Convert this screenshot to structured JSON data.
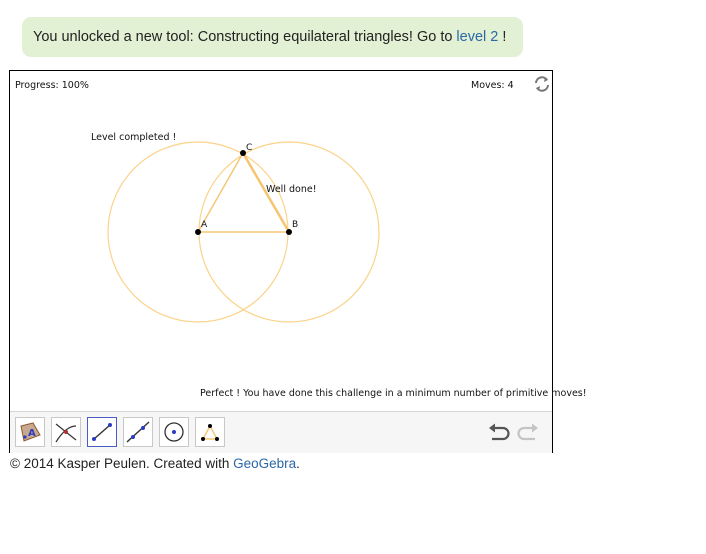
{
  "banner": {
    "text_before": "You unlocked a new tool: Constructing equilateral triangles! Go to",
    "link": "level 2",
    "text_after": "!"
  },
  "applet": {
    "progress": "Progress: 100%",
    "moves": "Moves: 4",
    "level_completed": "Level completed !",
    "well_done": "Well done!",
    "perfect": "Perfect ! You have done this challenge in a minimum number of primitive moves!",
    "points": {
      "a": "A",
      "b": "B",
      "c": "C"
    },
    "colors": {
      "circle": "#fbd38a",
      "segment": "#f6c572",
      "point": "#000000",
      "selected_tool": "#4a5bc4"
    },
    "icons": [
      "refresh-icon",
      "polygon-tool-icon",
      "intersect-tool-icon",
      "segment-tool-icon",
      "line-tool-icon",
      "circle-tool-icon",
      "equilateral-triangle-tool-icon",
      "undo-icon",
      "redo-icon"
    ]
  },
  "footer": {
    "text": "© 2014 Kasper Peulen. Created with",
    "link": "GeoGebra",
    "period": "."
  }
}
